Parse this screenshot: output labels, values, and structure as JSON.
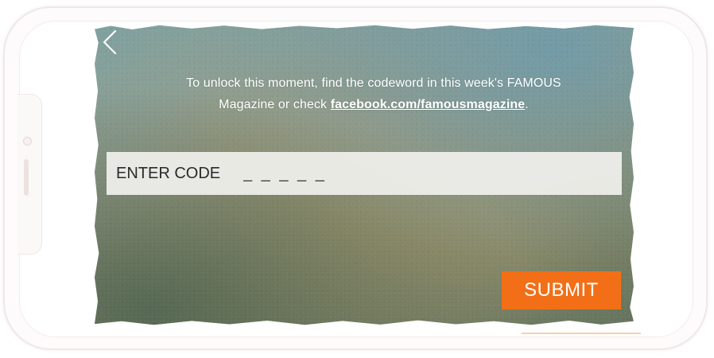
{
  "screen": {
    "instruction_line1": "To unlock this moment, find the codeword in this week's FAMOUS",
    "instruction_line2_prefix": "Magazine or check ",
    "instruction_link": "facebook.com/famousmagazine",
    "instruction_line2_suffix": ".",
    "back_icon": "chevron-left-icon"
  },
  "code_entry": {
    "label": "ENTER CODE",
    "placeholder": "_ _ _ _ _",
    "value": ""
  },
  "actions": {
    "submit_label": "SUBMIT"
  },
  "colors": {
    "accent": "#f36f17",
    "text_light": "#ffffff",
    "input_bg": "#eeeeea"
  }
}
